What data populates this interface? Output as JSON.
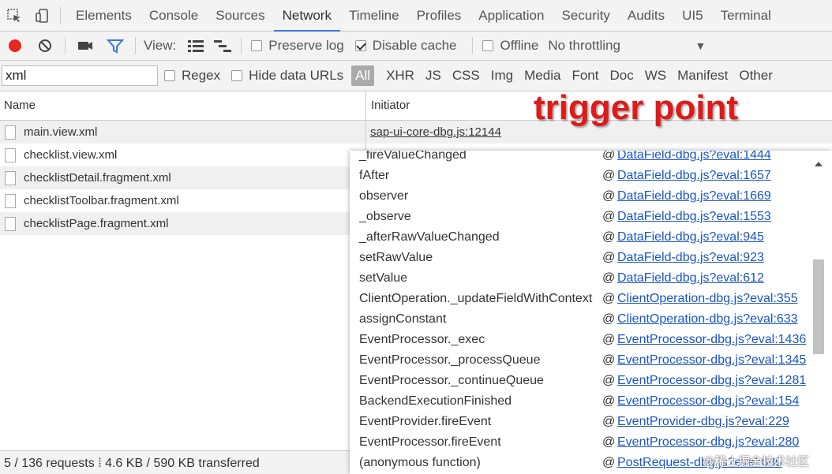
{
  "tabs": [
    "Elements",
    "Console",
    "Sources",
    "Network",
    "Timeline",
    "Profiles",
    "Application",
    "Security",
    "Audits",
    "UI5",
    "Terminal"
  ],
  "active_tab": "Network",
  "toolbar": {
    "view_label": "View:",
    "preserve_log": "Preserve log",
    "disable_cache": "Disable cache",
    "offline": "Offline",
    "throttling": "No throttling",
    "colors": {
      "record": "#e6281f",
      "filter_active": "#3879d9"
    }
  },
  "filter": {
    "value": "xml",
    "regex": "Regex",
    "hide_data_urls": "Hide data URLs",
    "types": [
      "All",
      "XHR",
      "JS",
      "CSS",
      "Img",
      "Media",
      "Font",
      "Doc",
      "WS",
      "Manifest",
      "Other"
    ]
  },
  "table": {
    "col_name": "Name",
    "col_initiator": "Initiator",
    "rows": [
      {
        "name": "main.view.xml",
        "initiator": "sap-ui-core-dbg.js:12144"
      },
      {
        "name": "checklist.view.xml",
        "initiator": ""
      },
      {
        "name": "checklistDetail.fragment.xml",
        "initiator": ""
      },
      {
        "name": "checklistToolbar.fragment.xml",
        "initiator": ""
      },
      {
        "name": "checklistPage.fragment.xml",
        "initiator": ""
      }
    ]
  },
  "annotation": "trigger point",
  "status": "5 / 136 requests  ⁞  4.6 KB / 590 KB transferred",
  "stack": [
    {
      "fn": "_fireValueChanged",
      "loc": "DataField-dbg.js?eval:1444"
    },
    {
      "fn": "fAfter",
      "loc": "DataField-dbg.js?eval:1657"
    },
    {
      "fn": "observer",
      "loc": "DataField-dbg.js?eval:1669"
    },
    {
      "fn": "_observe",
      "loc": "DataField-dbg.js?eval:1553"
    },
    {
      "fn": "_afterRawValueChanged",
      "loc": "DataField-dbg.js?eval:945"
    },
    {
      "fn": "setRawValue",
      "loc": "DataField-dbg.js?eval:923"
    },
    {
      "fn": "setValue",
      "loc": "DataField-dbg.js?eval:612"
    },
    {
      "fn": "ClientOperation._updateFieldWithContext",
      "loc": "ClientOperation-dbg.js?eval:355"
    },
    {
      "fn": "assignConstant",
      "loc": "ClientOperation-dbg.js?eval:633"
    },
    {
      "fn": "EventProcessor._exec",
      "loc": "EventProcessor-dbg.js?eval:1436"
    },
    {
      "fn": "EventProcessor._processQueue",
      "loc": "EventProcessor-dbg.js?eval:1345"
    },
    {
      "fn": "EventProcessor._continueQueue",
      "loc": "EventProcessor-dbg.js?eval:1281"
    },
    {
      "fn": "BackendExecutionFinished",
      "loc": "EventProcessor-dbg.js?eval:154"
    },
    {
      "fn": "EventProvider.fireEvent",
      "loc": "EventProvider-dbg.js?eval:229"
    },
    {
      "fn": "EventProcessor.fireEvent",
      "loc": "EventProcessor-dbg.js?eval:280"
    },
    {
      "fn": "(anonymous function)",
      "loc": "PostRequest-dbg.js?eval:680"
    }
  ],
  "watermark": "@稀土掘金技术社区"
}
